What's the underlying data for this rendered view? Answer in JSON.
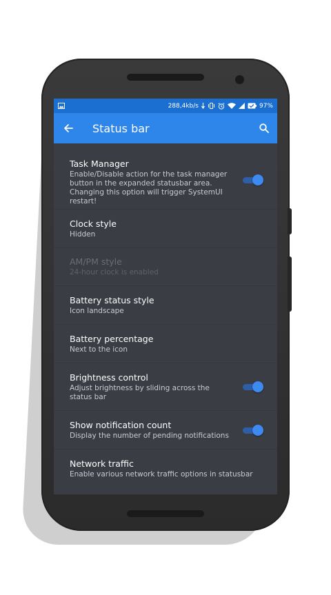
{
  "status_bar": {
    "network_speed": "288,4kb/s",
    "battery_percent": "97%",
    "icons": [
      "image-icon",
      "vibrate-icon",
      "alarm-icon",
      "wifi-icon",
      "signal-icon",
      "battery-icon"
    ]
  },
  "app_bar": {
    "title": "Status bar",
    "icons": [
      "back-arrow-icon",
      "search-icon"
    ]
  },
  "settings": [
    {
      "title": "Task Manager",
      "summary": "Enable/Disable action for the task manager button in the expanded statusbar area. Changing this option will trigger SystemUI restart!",
      "toggle": true,
      "enabled": true
    },
    {
      "title": "Clock style",
      "summary": "Hidden",
      "toggle": false,
      "enabled": true
    },
    {
      "title": "AM/PM style",
      "summary": "24-hour clock is enabled",
      "toggle": false,
      "enabled": false
    },
    {
      "title": "Battery status style",
      "summary": "Icon landscape",
      "toggle": false,
      "enabled": true
    },
    {
      "title": "Battery percentage",
      "summary": "Next to the icon",
      "toggle": false,
      "enabled": true
    },
    {
      "title": "Brightness control",
      "summary": "Adjust brightness by sliding across the status bar",
      "toggle": true,
      "enabled": true
    },
    {
      "title": "Show notification count",
      "summary": "Display the number of pending notifications",
      "toggle": true,
      "enabled": true
    },
    {
      "title": "Network traffic",
      "summary": "Enable various network traffic options in statusbar",
      "toggle": false,
      "enabled": true
    }
  ],
  "colors": {
    "status_bar": "#1a6fd0",
    "app_bar": "#2f86ea",
    "background": "#3a3d44",
    "switch_thumb": "#3d8af0",
    "switch_track": "#2e5fa6"
  }
}
